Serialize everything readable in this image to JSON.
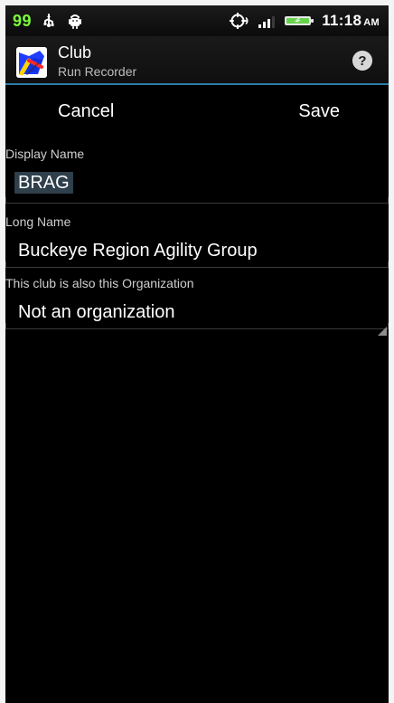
{
  "status_bar": {
    "notification_number": "99",
    "usb_icon": "usb-icon",
    "debug_icon": "android-debug-icon",
    "gps_icon": "gps-icon",
    "signal_icon": "signal-icon",
    "battery_icon": "battery-icon",
    "time": "11:18",
    "ampm": "AM",
    "colors": {
      "notification": "#7cff3a",
      "battery_fill": "#67d34c"
    }
  },
  "action_bar": {
    "app_icon": "run-recorder-app-icon",
    "title": "Club",
    "subtitle": "Run Recorder",
    "help_icon": "help-icon",
    "help_glyph": "?",
    "accent_color": "#2c7ea6"
  },
  "top_actions": {
    "cancel": "Cancel",
    "save": "Save"
  },
  "form": {
    "display_name": {
      "label": "Display Name",
      "value": "BRAG"
    },
    "long_name": {
      "label": "Long Name",
      "value": "Buckeye Region Agility Group"
    },
    "organization": {
      "label": "This club is also this Organization",
      "selected": "Not an organization",
      "spinner_icon": "spinner-triangle-icon"
    }
  }
}
